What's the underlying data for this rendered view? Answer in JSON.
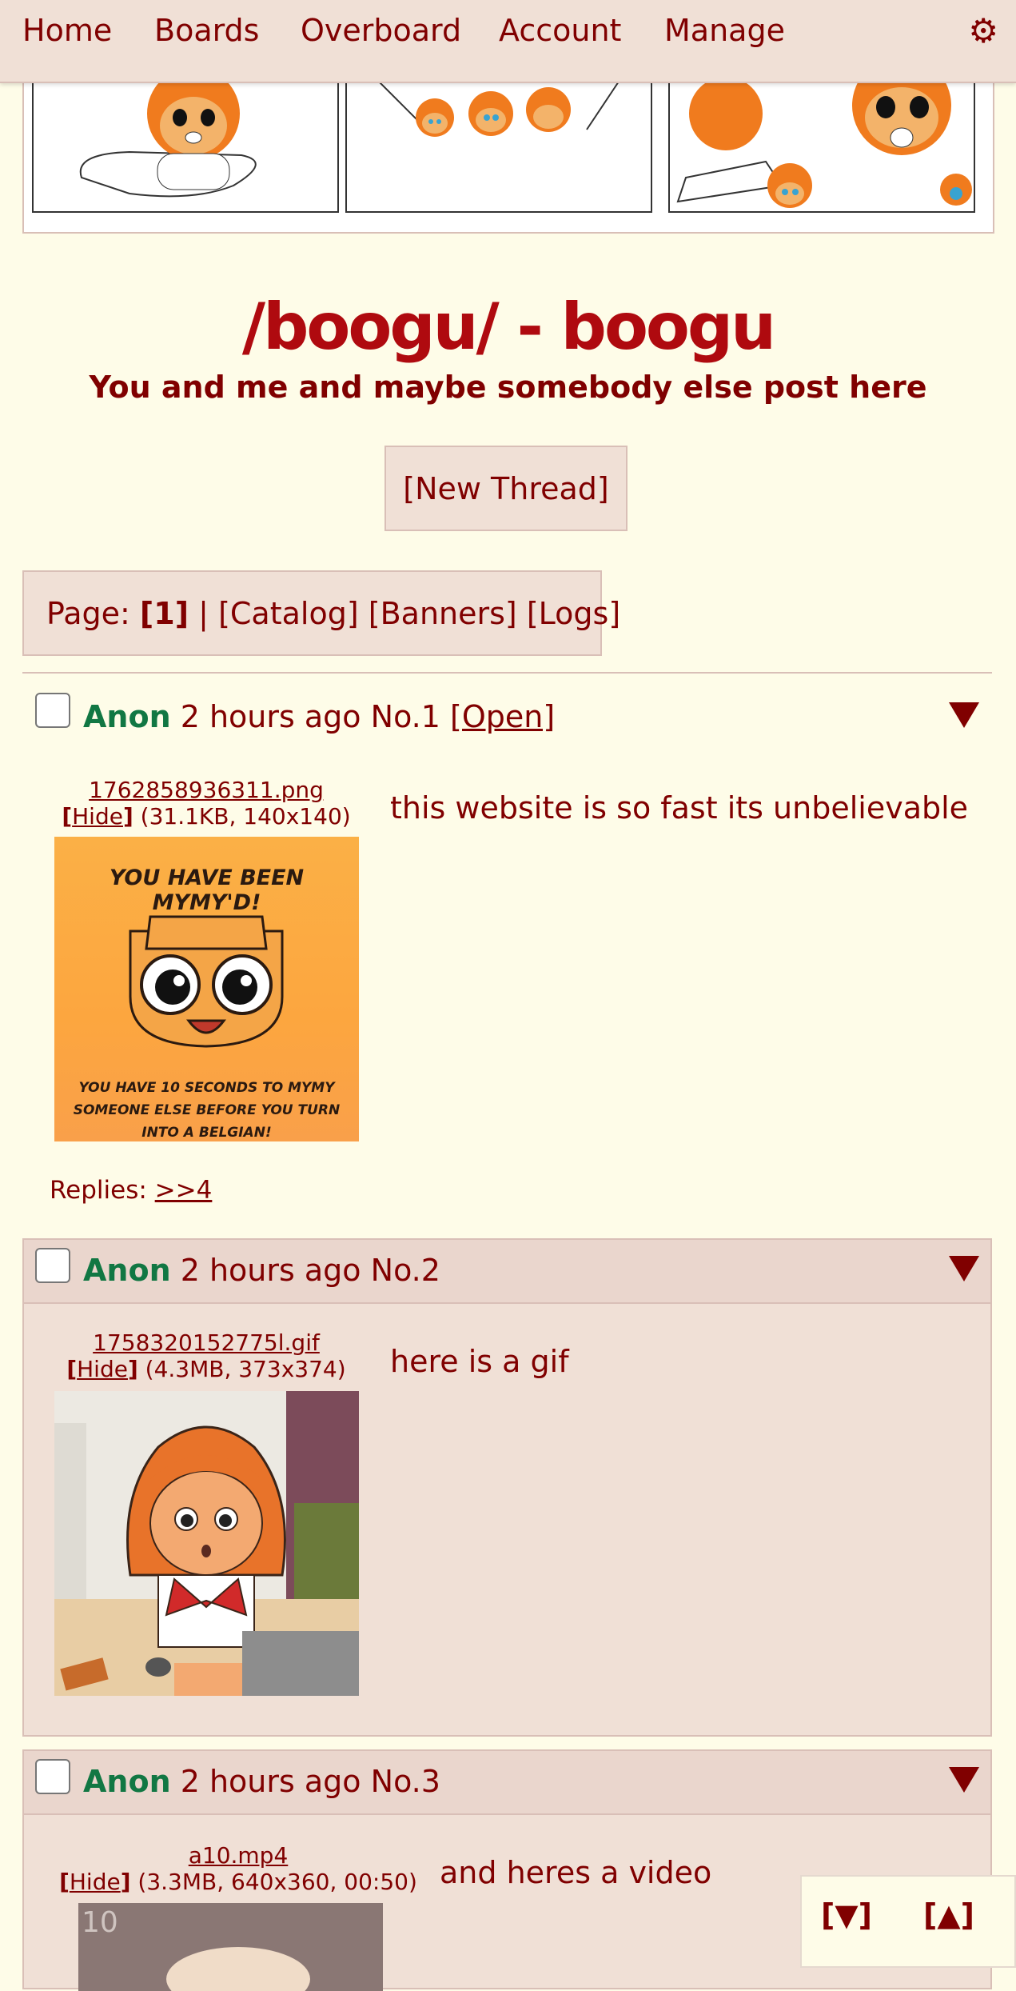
{
  "nav": {
    "items": [
      "Home",
      "Boards",
      "Overboard",
      "Account",
      "Manage"
    ],
    "settings_icon": "gear-icon"
  },
  "board": {
    "title": "/boogu/ - boogu",
    "subtitle": "You and me and maybe somebody else post here",
    "new_thread": "[New Thread]"
  },
  "pagination": {
    "prefix": "Page:",
    "current": "[1]",
    "separator": "|",
    "links": [
      "[Catalog]",
      "[Banners]",
      "[Logs]"
    ]
  },
  "posts": [
    {
      "name": "Anon",
      "time": "2 hours ago",
      "number": "No.1",
      "open_link": "[Open]",
      "filename": "1762858936311.png",
      "hide": "Hide",
      "filemeta": "(31.1KB, 140x140)",
      "message": "this website is so fast its unbelievable",
      "thumb_top_text": "YOU HAVE BEEN MYMY'D!",
      "thumb_bottom_text": "YOU HAVE 10 SECONDS TO MYMY SOMEONE ELSE BEFORE YOU TURN INTO A BELGIAN!",
      "replies_label": "Replies:",
      "replies_link": ">>4"
    },
    {
      "name": "Anon",
      "time": "2 hours ago",
      "number": "No.2",
      "filename": "1758320152775l.gif",
      "hide": "Hide",
      "filemeta": "(4.3MB, 373x374)",
      "message": "here is a gif"
    },
    {
      "name": "Anon",
      "time": "2 hours ago",
      "number": "No.3",
      "filename": "a10.mp4",
      "hide": "Hide",
      "filemeta": "(3.3MB, 640x360, 00:50)",
      "message": "and heres a video",
      "video_overlay_text": "10"
    }
  ],
  "float_nav": {
    "down": "[▼]",
    "up": "[▲]"
  },
  "colors": {
    "background": "#fefce8",
    "post_bg": "#f0e0d6",
    "border": "#d9bfb7",
    "text": "#800000",
    "title": "#af0a0f",
    "name": "#117743"
  }
}
